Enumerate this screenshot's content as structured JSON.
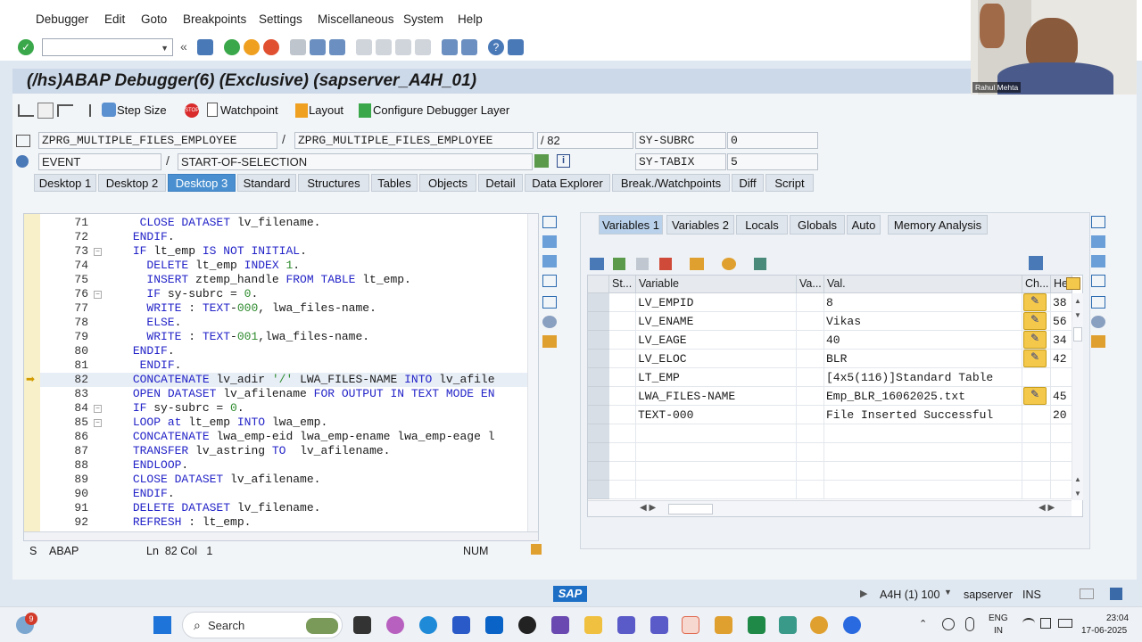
{
  "menu": [
    "Debugger",
    "Edit",
    "Goto",
    "Breakpoints",
    "Settings",
    "Miscellaneous",
    "System",
    "Help"
  ],
  "window_title": "(/hs)ABAP Debugger(6)  (Exclusive) (sapserver_A4H_01)",
  "debug_toolbar": {
    "step_size": "Step Size",
    "watchpoint": "Watchpoint",
    "layout": "Layout",
    "configure": "Configure Debugger Layer"
  },
  "context": {
    "program": "ZPRG_MULTIPLE_FILES_EMPLOYEE",
    "include": "ZPRG_MULTIPLE_FILES_EMPLOYEE",
    "line": "/ 82",
    "event_type": "EVENT",
    "event_name": "START-OF-SELECTION",
    "sy1_name": "SY-SUBRC",
    "sy1_val": "0",
    "sy2_name": "SY-TABIX",
    "sy2_val": "5"
  },
  "tabs": [
    "Desktop 1",
    "Desktop 2",
    "Desktop 3",
    "Standard",
    "Structures",
    "Tables",
    "Objects",
    "Detail",
    "Data Explorer",
    "Break./Watchpoints",
    "Diff",
    "Script"
  ],
  "active_tab": "Desktop 3",
  "code_lines": [
    {
      "n": "71",
      "html": "  <span class='kw'>CLOSE DATASET</span> lv_filename."
    },
    {
      "n": "72",
      "html": " <span class='kw'>ENDIF</span>."
    },
    {
      "n": "73",
      "html": " <span class='kw'>IF</span> lt_emp <span class='kw'>IS NOT INITIAL</span>."
    },
    {
      "n": "74",
      "html": "   <span class='kw'>DELETE</span> lt_emp <span class='kw'>INDEX</span> <span class='num'>1</span>."
    },
    {
      "n": "75",
      "html": "   <span class='kw'>INSERT</span> ztemp_handle <span class='kw'>FROM TABLE</span> lt_emp."
    },
    {
      "n": "76",
      "html": "   <span class='kw'>IF</span> sy-subrc = <span class='num'>0</span>."
    },
    {
      "n": "77",
      "html": "   <span class='kw'>WRITE</span> : <span class='kw'>TEXT</span>-<span class='num'>000</span>, lwa_files-name."
    },
    {
      "n": "78",
      "html": "   <span class='kw'>ELSE</span>."
    },
    {
      "n": "79",
      "html": "   <span class='kw'>WRITE</span> : <span class='kw'>TEXT</span>-<span class='num'>001</span>,lwa_files-name."
    },
    {
      "n": "80",
      "html": " <span class='kw'>ENDIF</span>."
    },
    {
      "n": "81",
      "html": "  <span class='kw'>ENDIF</span>."
    },
    {
      "n": "82",
      "html": " <span class='kw'>CONCATENATE</span> lv_adir <span class='str'>'/'</span> LWA_FILES-NAME <span class='kw'>INTO</span> lv_afile"
    },
    {
      "n": "83",
      "html": " <span class='kw'>OPEN DATASET</span> lv_afilename <span class='kw'>FOR OUTPUT IN TEXT MODE EN</span>"
    },
    {
      "n": "84",
      "html": " <span class='kw'>IF</span> sy-subrc = <span class='num'>0</span>."
    },
    {
      "n": "85",
      "html": " <span class='kw'>LOOP at</span> lt_emp <span class='kw'>INTO</span> lwa_emp."
    },
    {
      "n": "86",
      "html": " <span class='kw'>CONCATENATE</span> lwa_emp-eid lwa_emp-ename lwa_emp-eage l"
    },
    {
      "n": "87",
      "html": " <span class='kw'>TRANSFER</span> lv_astring <span class='kw'>TO</span>  lv_afilename."
    },
    {
      "n": "88",
      "html": " <span class='kw'>ENDLOOP</span>."
    },
    {
      "n": "89",
      "html": " <span class='kw'>CLOSE DATASET</span> lv_afilename."
    },
    {
      "n": "90",
      "html": " <span class='kw'>ENDIF</span>."
    },
    {
      "n": "91",
      "html": " <span class='kw'>DELETE DATASET</span> lv_filename."
    },
    {
      "n": "92",
      "html": " <span class='kw'>REFRESH</span> : lt_emp."
    }
  ],
  "editor_status": {
    "mode": "S",
    "lang": "ABAP",
    "pos": "Ln  82 Col   1",
    "num": "NUM"
  },
  "var_tabs": [
    "Variables 1",
    "Variables 2",
    "Locals",
    "Globals",
    "Auto",
    "Memory Analysis"
  ],
  "grid_headers": {
    "st": "St...",
    "variable": "Variable",
    "va": "Va...",
    "val": "Val.",
    "ch": "Ch...",
    "he": "He"
  },
  "variables": [
    {
      "name": "LV_EMPID",
      "val": "8",
      "edit": true,
      "hex": "38"
    },
    {
      "name": "LV_ENAME",
      "val": "Vikas",
      "edit": true,
      "hex": "56"
    },
    {
      "name": "LV_EAGE",
      "val": "40",
      "edit": true,
      "hex": "34"
    },
    {
      "name": "LV_ELOC",
      "val": "BLR",
      "edit": true,
      "hex": "42"
    },
    {
      "name": "LT_EMP",
      "val": "[4x5(116)]Standard Table",
      "edit": false,
      "hex": ""
    },
    {
      "name": "LWA_FILES-NAME",
      "val": "Emp_BLR_16062025.txt",
      "edit": true,
      "hex": "45"
    },
    {
      "name": "TEXT-000",
      "val": " File Inserted Successful",
      "edit": false,
      "hex": "20"
    }
  ],
  "sap_status": {
    "logo": "SAP",
    "system": "A4H (1) 100",
    "server": "sapserver",
    "mode": "INS"
  },
  "webcam_name": "Rahul Mehta",
  "taskbar": {
    "search": "Search",
    "lang1": "ENG",
    "lang2": "IN",
    "time": "23:04",
    "date": "17-06-2025",
    "badge": "9"
  }
}
